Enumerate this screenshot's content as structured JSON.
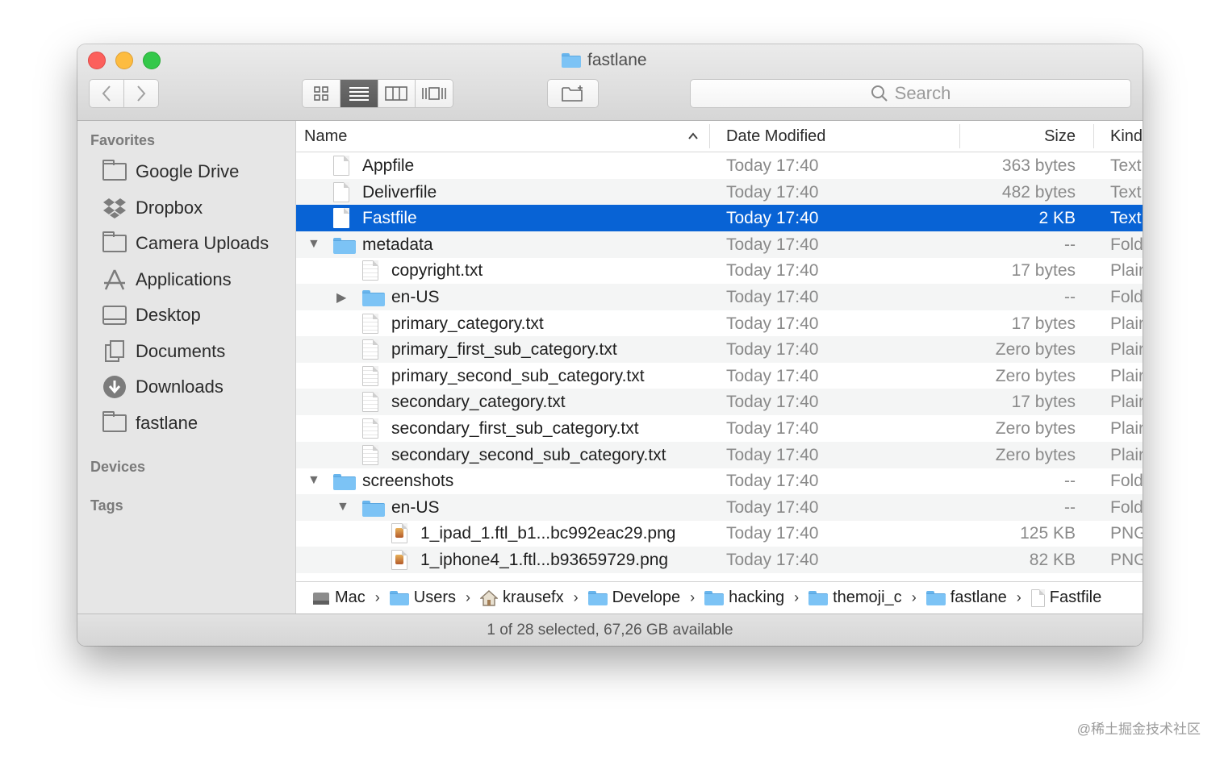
{
  "window": {
    "title": "fastlane"
  },
  "toolbar": {
    "back_icon": "chevron-left-icon",
    "forward_icon": "chevron-right-icon",
    "view_modes": [
      "icon-view",
      "list-view",
      "column-view",
      "cover-flow-view"
    ],
    "active_view": "list-view",
    "search_placeholder": "Search"
  },
  "sidebar": {
    "favorites_label": "Favorites",
    "items": [
      {
        "label": "Google Drive",
        "icon": "folder-icon"
      },
      {
        "label": "Dropbox",
        "icon": "dropbox-icon"
      },
      {
        "label": "Camera Uploads",
        "icon": "folder-icon"
      },
      {
        "label": "Applications",
        "icon": "applications-icon"
      },
      {
        "label": "Desktop",
        "icon": "desktop-icon"
      },
      {
        "label": "Documents",
        "icon": "documents-icon"
      },
      {
        "label": "Downloads",
        "icon": "downloads-icon"
      },
      {
        "label": "fastlane",
        "icon": "folder-icon"
      }
    ],
    "devices_label": "Devices",
    "tags_label": "Tags"
  },
  "columns": {
    "name": "Name",
    "date": "Date Modified",
    "size": "Size",
    "kind": "Kind"
  },
  "files": [
    {
      "name": "Appfile",
      "date": "Today 17:40",
      "size": "363 bytes",
      "kind": "Text",
      "depth": 0,
      "type": "doc",
      "disclosure": ""
    },
    {
      "name": "Deliverfile",
      "date": "Today 17:40",
      "size": "482 bytes",
      "kind": "Text",
      "depth": 0,
      "type": "doc",
      "disclosure": ""
    },
    {
      "name": "Fastfile",
      "date": "Today 17:40",
      "size": "2 KB",
      "kind": "Text",
      "depth": 0,
      "type": "doc",
      "disclosure": "",
      "selected": true
    },
    {
      "name": "metadata",
      "date": "Today 17:40",
      "size": "--",
      "kind": "Fold",
      "depth": 0,
      "type": "folder",
      "disclosure": "open"
    },
    {
      "name": "copyright.txt",
      "date": "Today 17:40",
      "size": "17 bytes",
      "kind": "Plair",
      "depth": 1,
      "type": "lined",
      "disclosure": ""
    },
    {
      "name": "en-US",
      "date": "Today 17:40",
      "size": "--",
      "kind": "Fold",
      "depth": 1,
      "type": "folder",
      "disclosure": "closed"
    },
    {
      "name": "primary_category.txt",
      "date": "Today 17:40",
      "size": "17 bytes",
      "kind": "Plair",
      "depth": 1,
      "type": "lined",
      "disclosure": ""
    },
    {
      "name": "primary_first_sub_category.txt",
      "date": "Today 17:40",
      "size": "Zero bytes",
      "kind": "Plair",
      "depth": 1,
      "type": "lined",
      "disclosure": ""
    },
    {
      "name": "primary_second_sub_category.txt",
      "date": "Today 17:40",
      "size": "Zero bytes",
      "kind": "Plair",
      "depth": 1,
      "type": "lined",
      "disclosure": ""
    },
    {
      "name": "secondary_category.txt",
      "date": "Today 17:40",
      "size": "17 bytes",
      "kind": "Plair",
      "depth": 1,
      "type": "lined",
      "disclosure": ""
    },
    {
      "name": "secondary_first_sub_category.txt",
      "date": "Today 17:40",
      "size": "Zero bytes",
      "kind": "Plair",
      "depth": 1,
      "type": "lined",
      "disclosure": ""
    },
    {
      "name": "secondary_second_sub_category.txt",
      "date": "Today 17:40",
      "size": "Zero bytes",
      "kind": "Plair",
      "depth": 1,
      "type": "lined",
      "disclosure": ""
    },
    {
      "name": "screenshots",
      "date": "Today 17:40",
      "size": "--",
      "kind": "Fold",
      "depth": 0,
      "type": "folder",
      "disclosure": "open"
    },
    {
      "name": "en-US",
      "date": "Today 17:40",
      "size": "--",
      "kind": "Fold",
      "depth": 1,
      "type": "folder",
      "disclosure": "open"
    },
    {
      "name": "1_ipad_1.ftl_b1...bc992eac29.png",
      "date": "Today 17:40",
      "size": "125 KB",
      "kind": "PNG",
      "depth": 2,
      "type": "img",
      "disclosure": ""
    },
    {
      "name": "1_iphone4_1.ftl...b93659729.png",
      "date": "Today 17:40",
      "size": "82 KB",
      "kind": "PNG",
      "depth": 2,
      "type": "img",
      "disclosure": ""
    }
  ],
  "pathbar": [
    {
      "label": "Mac",
      "icon": "hard-drive-icon"
    },
    {
      "label": "Users",
      "icon": "folder-icon"
    },
    {
      "label": "krausefx",
      "icon": "home-icon"
    },
    {
      "label": "Develope",
      "icon": "folder-icon"
    },
    {
      "label": "hacking",
      "icon": "folder-icon"
    },
    {
      "label": "themoji_c",
      "icon": "folder-icon"
    },
    {
      "label": "fastlane",
      "icon": "folder-icon"
    },
    {
      "label": "Fastfile",
      "icon": "document-icon"
    }
  ],
  "status": "1 of 28 selected, 67,26 GB available",
  "watermark": "@稀土掘金技术社区",
  "colors": {
    "selection": "#0863d5",
    "folder": "#7cc3f5",
    "close": "#fc605c",
    "minimize": "#fdbc40",
    "zoom": "#34c84a"
  }
}
